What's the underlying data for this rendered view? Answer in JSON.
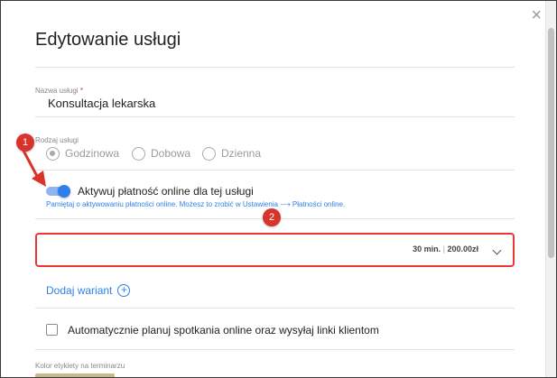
{
  "dialog": {
    "title": "Edytowanie usługi",
    "close_glyph": "×"
  },
  "fields": {
    "service_name": {
      "label": "Nazwa usługi",
      "required_mark": "*",
      "value": "Konsultacja lekarska"
    },
    "service_type": {
      "label": "Rodzaj usługi",
      "options": [
        "Godzinowa",
        "Dobowa",
        "Dzienna"
      ],
      "selected": "Godzinowa"
    }
  },
  "online_payment": {
    "enabled": true,
    "label": "Aktywuj płatność online dla tej usługi",
    "hint": "Pamiętaj o aktywowaniu płatności online. Możesz to zrobić w Ustawienia ⟶ Płatności online."
  },
  "variant": {
    "duration": "30 min.",
    "separator": "|",
    "price": "200.00zł"
  },
  "add_variant_label": "Dodaj wariant",
  "auto_schedule": {
    "checked": false,
    "label": "Automatycznie planuj spotkania online oraz wysyłaj linki klientom"
  },
  "terminal_color": {
    "label": "Kolor etykiety na terminarzu",
    "value": "#c8b88a"
  },
  "annotations": [
    "1",
    "2"
  ],
  "colors": {
    "accent": "#2f80ed",
    "annotation": "#d9342b",
    "highlight_border": "#e53935"
  },
  "icons": {
    "close": "close-icon",
    "chevron": "chevron-down-icon",
    "add": "plus-circle-icon",
    "arrow": "red-arrow-icon"
  }
}
